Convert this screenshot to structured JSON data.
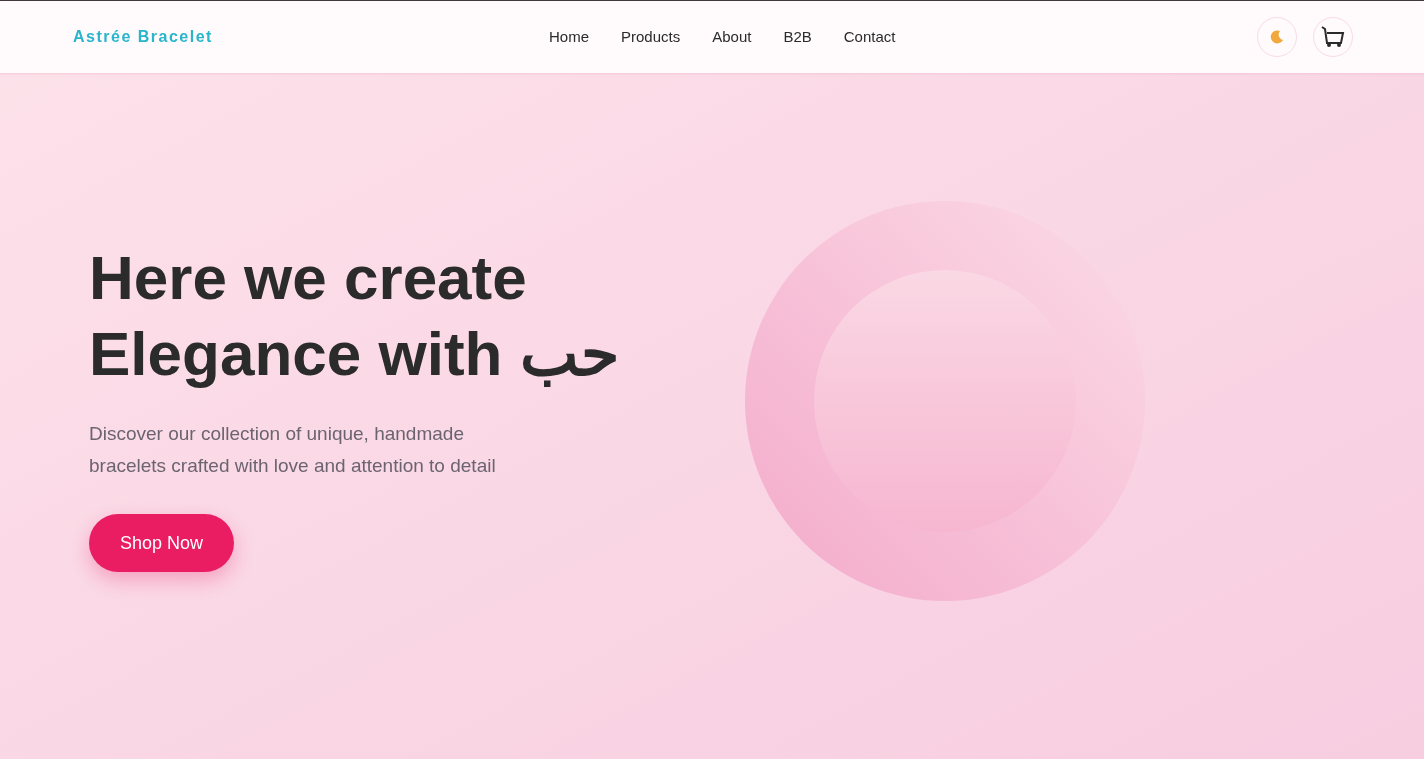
{
  "brand": "Astrée Bracelet",
  "nav": [
    "Home",
    "Products",
    "About",
    "B2B",
    "Contact"
  ],
  "hero": {
    "title_line1": "Here we create",
    "title_line2": "Elegance with حب",
    "subtitle": "Discover our collection of unique, handmade bracelets crafted with love and attention to detail",
    "button": "Shop Now"
  }
}
